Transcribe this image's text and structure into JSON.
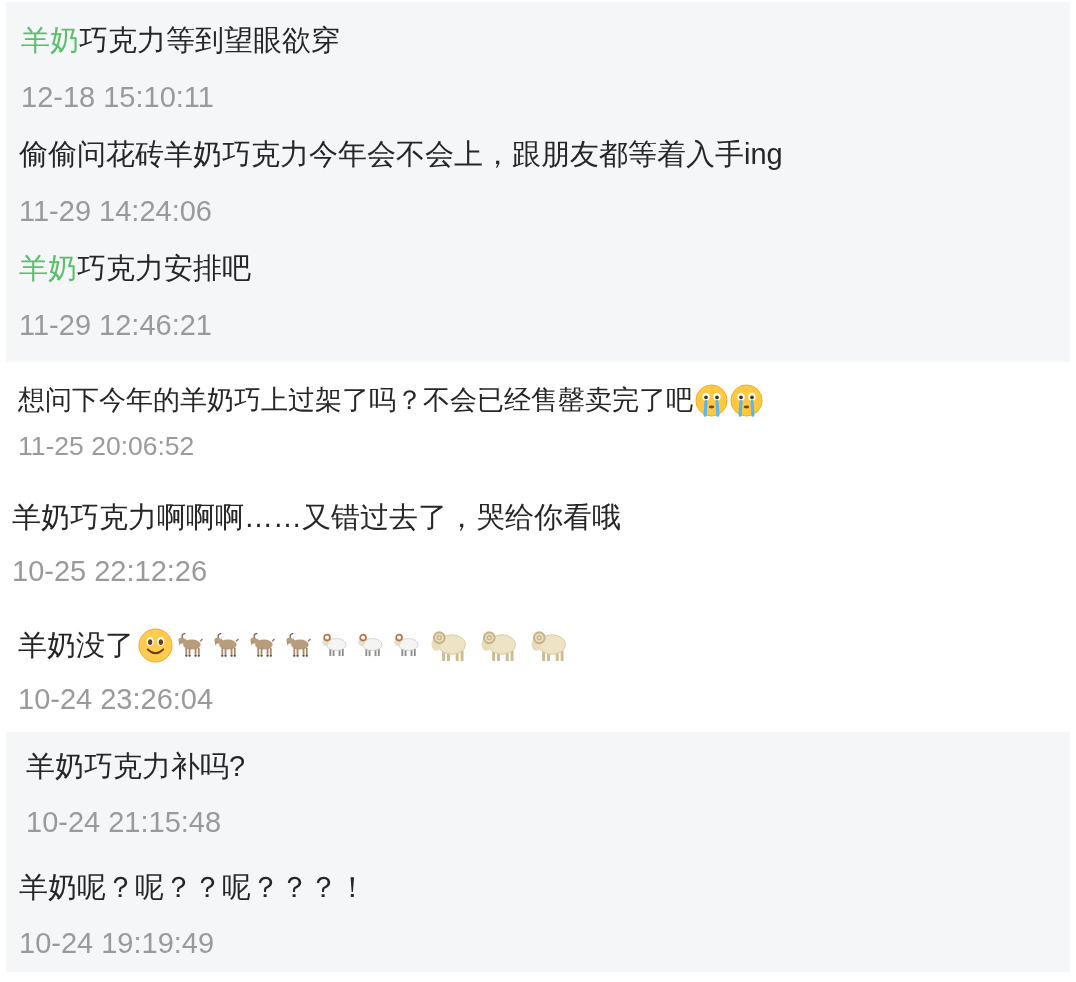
{
  "panels": [
    {
      "kind": "card",
      "comments": [
        {
          "text": [
            {
              "text": "羊奶",
              "highlighted": true
            },
            {
              "text": "巧克力等到望眼欲穿",
              "highlighted": false
            }
          ],
          "time": "12-18 15:10:11"
        },
        {
          "text": [
            {
              "text": "偷偷问花砖羊奶巧克力今年会不会上，跟朋友都等着入手ing",
              "highlighted": false
            }
          ],
          "time": "11-29 14:24:06"
        },
        {
          "text": [
            {
              "text": "羊奶",
              "highlighted": true
            },
            {
              "text": "巧克力安排吧",
              "highlighted": false
            }
          ],
          "time": "11-29 12:46:21"
        }
      ]
    },
    {
      "kind": "plain",
      "comments": [
        {
          "text": [
            {
              "text": "想问下今年的羊奶巧上过架了吗？不会已经售罄卖完了吧",
              "highlighted": false
            }
          ],
          "emoji": [
            {
              "kind": "crying"
            },
            {
              "kind": "crying"
            }
          ],
          "time": "11-25 20:06:52"
        }
      ]
    },
    {
      "kind": "plain",
      "comments": [
        {
          "text": [
            {
              "text": "羊奶巧克力啊啊啊……又错过去了，哭给你看哦",
              "highlighted": false
            }
          ],
          "time": "10-25 22:12:26"
        }
      ]
    },
    {
      "kind": "plain",
      "comments": [
        {
          "text": [
            {
              "text": "羊奶没了",
              "highlighted": false
            }
          ],
          "emoji": [
            {
              "kind": "smile"
            },
            {
              "kind": "goat"
            },
            {
              "kind": "goat"
            },
            {
              "kind": "goat"
            },
            {
              "kind": "goat"
            },
            {
              "kind": "ram"
            },
            {
              "kind": "ram"
            },
            {
              "kind": "ram"
            },
            {
              "kind": "sheep"
            },
            {
              "kind": "sheep"
            },
            {
              "kind": "sheep"
            }
          ],
          "time": "10-24 23:26:04"
        }
      ]
    },
    {
      "kind": "card",
      "comments": [
        {
          "text": [
            {
              "text": "羊奶巧克力补吗?",
              "highlighted": false
            }
          ],
          "time": "10-24 21:15:48"
        },
        {
          "text": [
            {
              "text": "羊奶呢？呢？？呢？？？！",
              "highlighted": false
            }
          ],
          "time": "10-24 19:19:49"
        }
      ]
    }
  ]
}
